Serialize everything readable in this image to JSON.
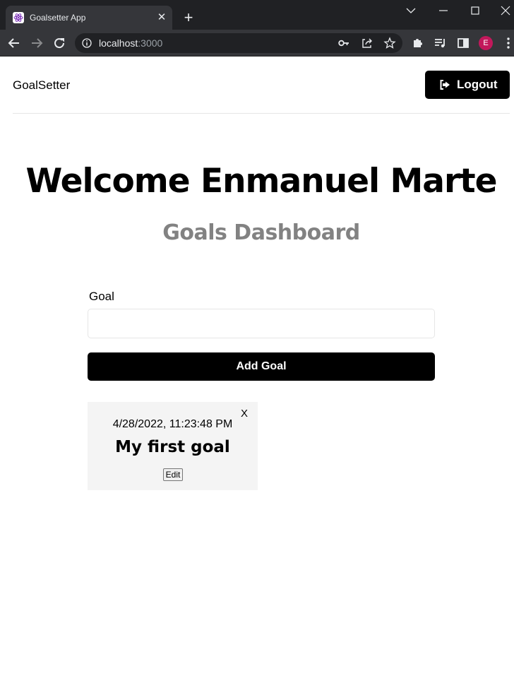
{
  "browser": {
    "tab": {
      "title": "Goalsetter App",
      "favicon": "react-atom-icon"
    },
    "address": {
      "host": "localhost",
      "port": ":3000"
    },
    "colors": {
      "chrome_dark": "#202124",
      "chrome_toolbar": "#35363a",
      "profile_avatar": "#c2185b"
    },
    "profile_initial": "E"
  },
  "header": {
    "logo": "GoalSetter",
    "logout_label": "Logout",
    "logout_icon": "sign-out-icon"
  },
  "heading": {
    "welcome": "Welcome Enmanuel Marte",
    "subtitle": "Goals Dashboard"
  },
  "form": {
    "goal_label": "Goal",
    "goal_value": "",
    "submit_label": "Add Goal"
  },
  "goals": [
    {
      "date": "4/28/2022, 11:23:48 PM",
      "text": "My first goal",
      "delete_label": "X",
      "edit_label": "Edit"
    }
  ],
  "colors": {
    "primary": "#000000",
    "subtitle": "#828282",
    "card_bg": "#f4f4f4"
  }
}
